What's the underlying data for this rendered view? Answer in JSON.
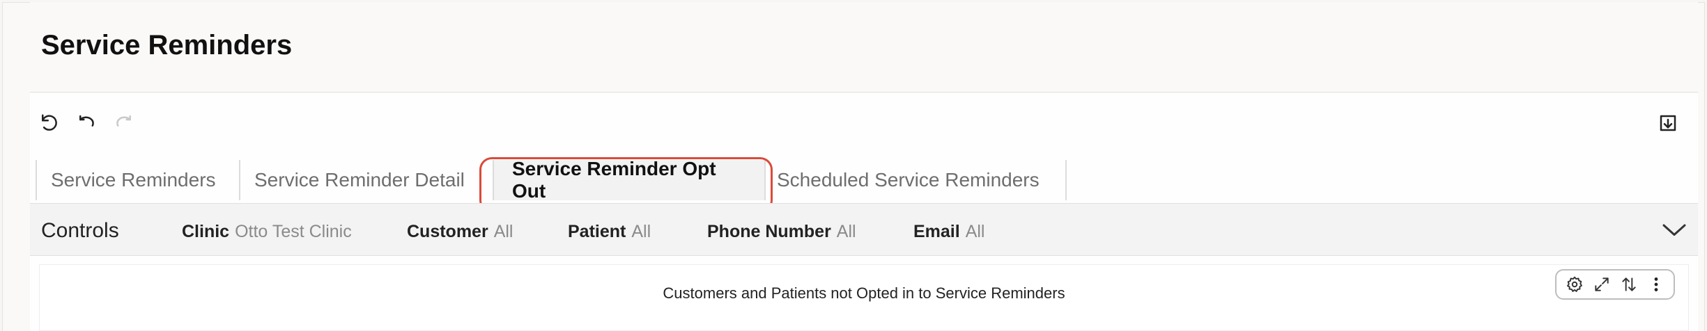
{
  "page": {
    "title": "Service Reminders"
  },
  "toolbar": {
    "reset_icon": "reset-icon",
    "undo_icon": "undo-icon",
    "redo_icon": "redo-icon",
    "download_icon": "download-icon"
  },
  "tabs": [
    {
      "label": "Service Reminders",
      "active": false
    },
    {
      "label": "Service Reminder Detail",
      "active": false
    },
    {
      "label": "Service Reminder Opt Out",
      "active": true
    },
    {
      "label": "Scheduled Service Reminders",
      "active": false
    }
  ],
  "controls": {
    "title": "Controls",
    "filters": [
      {
        "label": "Clinic",
        "value": "Otto Test Clinic"
      },
      {
        "label": "Customer",
        "value": "All"
      },
      {
        "label": "Patient",
        "value": "All"
      },
      {
        "label": "Phone Number",
        "value": "All"
      },
      {
        "label": "Email",
        "value": "All"
      }
    ]
  },
  "tile": {
    "title": "Customers and Patients not Opted in to Service Reminders"
  },
  "colors": {
    "highlight": "#d94b3a",
    "controls_bg": "#f3f3f3",
    "active_tab_bg": "#f2f2f2"
  }
}
